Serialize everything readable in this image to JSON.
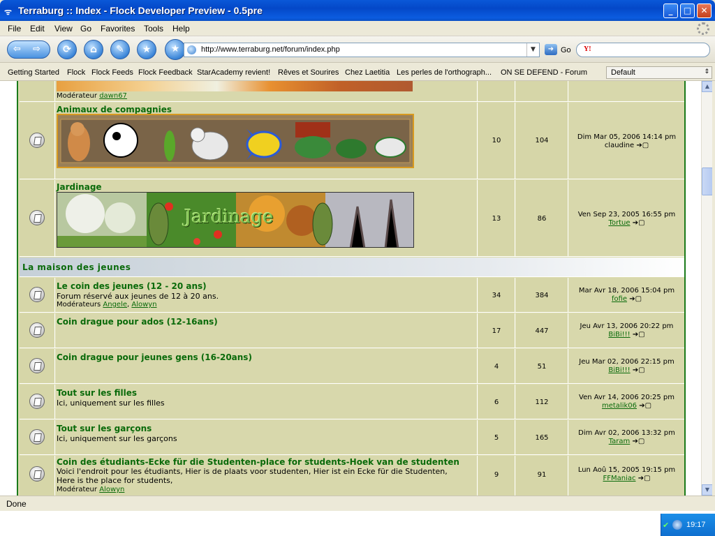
{
  "window": {
    "title": "Terraburg :: Index - Flock Developer Preview - 0.5pre",
    "min": "_",
    "max": "□",
    "close": "✕"
  },
  "menu": [
    "File",
    "Edit",
    "View",
    "Go",
    "Favorites",
    "Tools",
    "Help"
  ],
  "toolbar": {
    "url": "http://www.terraburg.net/forum/index.php",
    "go_label": "Go",
    "search_brand": "Y!"
  },
  "bookmarks": [
    "Getting Started",
    "Flock",
    "Flock Feeds",
    "Flock Feedback",
    "StarAcademy revient!",
    "Rêves et Sourires",
    "Chez Laetitia",
    "Les perles de l'orthograph...",
    "ON SE DEFEND - Forum"
  ],
  "bookmark_select": "Default",
  "forum": {
    "moderator_label": "Modérateur",
    "moderators_label": "Modérateurs",
    "top_row": {
      "moderator": "dawn67"
    },
    "rows_a": [
      {
        "title": "Animaux de compagnies",
        "topics": "10",
        "posts": "104",
        "last_date": "Dim Mar 05, 2006 14:14 pm",
        "last_user": "claudine",
        "banner": "animals"
      },
      {
        "title": "Jardinage",
        "topics": "13",
        "posts": "86",
        "last_date": "Ven Sep 23, 2005 16:55 pm",
        "last_user": "Tortue",
        "banner": "garden",
        "banner_text": "Jardinage"
      }
    ],
    "category": "La maison des jeunes",
    "rows_b": [
      {
        "title": "Le coin des jeunes (12 - 20 ans)",
        "desc": "Forum réservé aux jeunes de 12 à 20 ans.",
        "mods": [
          "Angele",
          "Alowyn"
        ],
        "topics": "34",
        "posts": "384",
        "last_date": "Mar Avr 18, 2006 15:04 pm",
        "last_user": "fofie"
      },
      {
        "title": "Coin drague pour ados (12-16ans)",
        "topics": "17",
        "posts": "447",
        "last_date": "Jeu Avr 13, 2006 20:22 pm",
        "last_user": "BiBi!!!"
      },
      {
        "title": "Coin drague pour jeunes gens (16-20ans)",
        "topics": "4",
        "posts": "51",
        "last_date": "Jeu Mar 02, 2006 22:15 pm",
        "last_user": "BiBi!!!"
      },
      {
        "title": "Tout sur les filles",
        "desc": "Ici, uniquement sur les filles",
        "topics": "6",
        "posts": "112",
        "last_date": "Ven Avr 14, 2006 20:25 pm",
        "last_user": "metalik06"
      },
      {
        "title": "Tout sur les garçons",
        "desc": "Ici, uniquement sur les garçons",
        "topics": "5",
        "posts": "165",
        "last_date": "Dim Avr 02, 2006 13:32 pm",
        "last_user": "Taram"
      },
      {
        "title": "Coin des étudiants-Ecke für die Studenten-place for students-Hoek van de studenten",
        "desc": "Voici l'endroit pour les étudiants, Hier is de plaats voor studenten, Hier ist ein Ecke für die Studenten,",
        "desc2": "Here is the place for students,",
        "mods1": "Alowyn",
        "topics": "9",
        "posts": "91",
        "last_date": "Lun Aoû 15, 2005 19:15 pm",
        "last_user": "FFManiac"
      }
    ]
  },
  "status": "Done",
  "clock": "19:17",
  "colors": {
    "title_green": "#0a6a0a",
    "row_bg": "#d8d8ac",
    "border_green": "#1a7a1a"
  }
}
